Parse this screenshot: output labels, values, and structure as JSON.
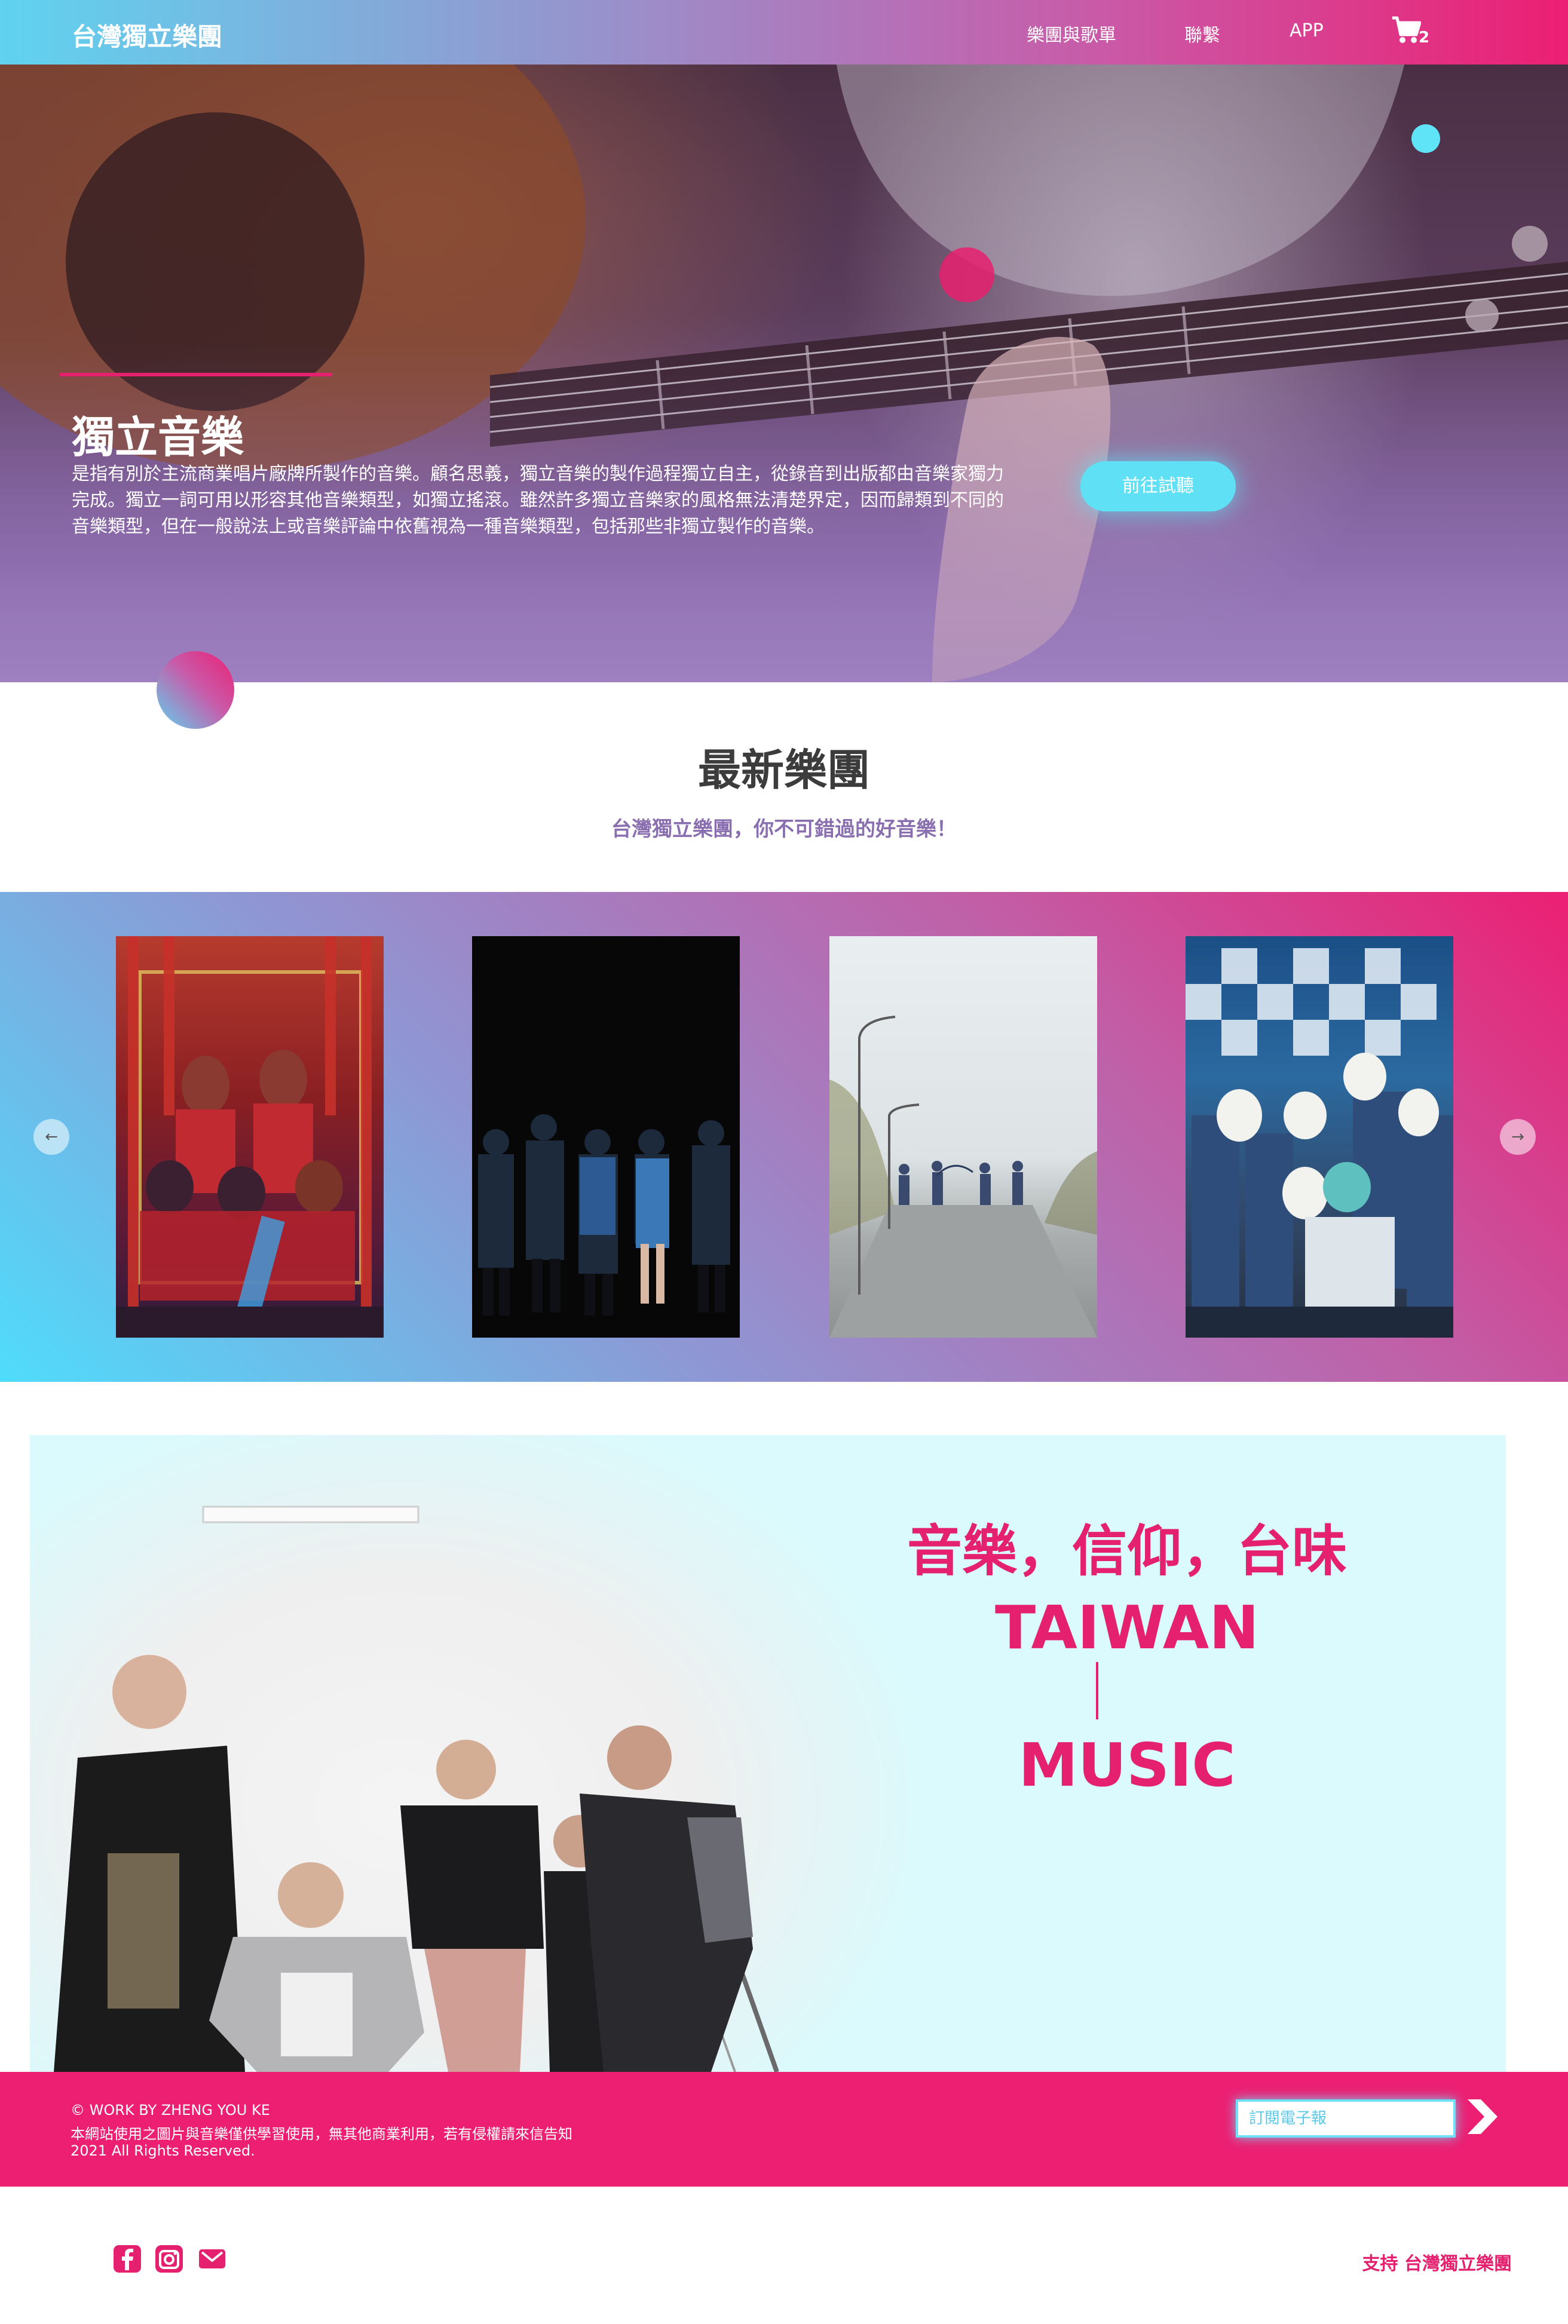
{
  "nav": {
    "brand": "台灣獨立樂團",
    "links": [
      "樂團與歌單",
      "聯繫",
      "APP"
    ],
    "cart_count": "2",
    "cart_icon": "cart-icon"
  },
  "hero": {
    "title": "獨立音樂",
    "description": "是指有別於主流商業唱片廠牌所製作的音樂。顧名思義，獨立音樂的製作過程獨立自主，從錄音到出版都由音樂家獨力完成。獨立一詞可用以形容其他音樂類型，如獨立搖滾。雖然許多獨立音樂家的風格無法清楚界定，因而歸類到不同的音樂類型，但在一般說法上或音樂評論中依舊視為一種音樂類型，包括那些非獨立製作的音樂。",
    "cta": "前往試聽"
  },
  "latest": {
    "title": "最新樂團",
    "subtitle": "台灣獨立樂團，你不可錯過的好音樂！",
    "prev_icon": "arrow-left-icon",
    "next_icon": "arrow-right-icon"
  },
  "feature": {
    "slogan": "音樂，信仰，台味",
    "line1": "TAIWAN",
    "line2": "MUSIC"
  },
  "footer": {
    "copyright": "© WORK BY ZHENG YOU KE",
    "notice": "本網站使用之圖片與音樂僅供學習使用，無其他商業利用，若有侵權請來信告知",
    "rights": "2021 All Rights Reserved.",
    "subscribe_placeholder": "訂閱電子報",
    "send_icon": "chevron-right-icon"
  },
  "bottom": {
    "support_prefix": "支持 ",
    "support_name": "台灣獨立樂團",
    "social_icons": [
      "facebook-icon",
      "instagram-icon",
      "mail-icon"
    ]
  },
  "colors": {
    "accent_pink": "#e5206e",
    "accent_cyan": "#5fe0f5",
    "purple": "#8a6fb0",
    "feature_bg": "#dafafd"
  }
}
